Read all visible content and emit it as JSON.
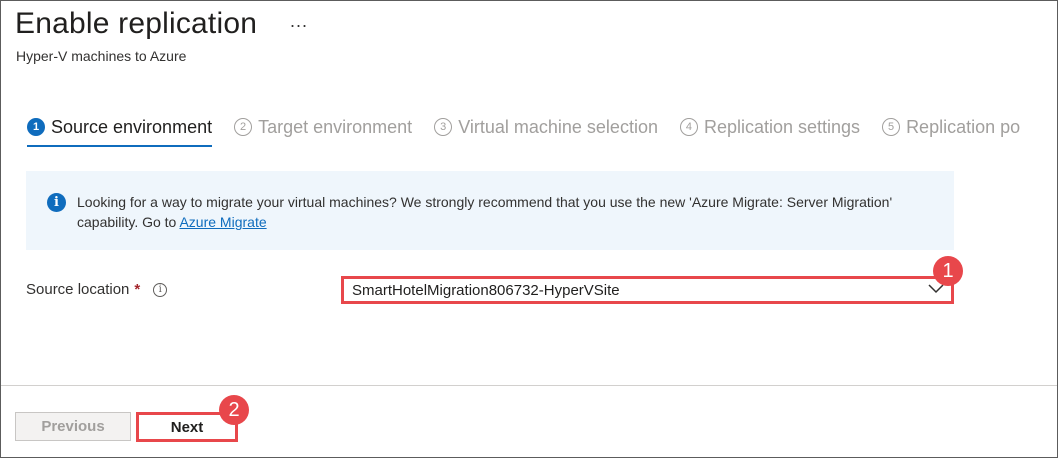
{
  "header": {
    "title": "Enable replication",
    "more_label": "...",
    "subtitle": "Hyper-V machines to Azure"
  },
  "tabs": [
    {
      "num": "1",
      "label": "Source environment",
      "active": true
    },
    {
      "num": "2",
      "label": "Target environment",
      "active": false
    },
    {
      "num": "3",
      "label": "Virtual machine selection",
      "active": false
    },
    {
      "num": "4",
      "label": "Replication settings",
      "active": false
    },
    {
      "num": "5",
      "label": "Replication po",
      "active": false
    }
  ],
  "info": {
    "icon": "info-icon",
    "icon_glyph": "i",
    "text": "Looking for a way to migrate your virtual machines? We strongly recommend that you use the new 'Azure Migrate: Server Migration' capability. Go to ",
    "link": "Azure Migrate"
  },
  "source_location": {
    "label": "Source location",
    "required_mark": "*",
    "info_glyph": "i",
    "value": "SmartHotelMigration806732-HyperVSite"
  },
  "callouts": {
    "one": "1",
    "two": "2"
  },
  "footer": {
    "previous_label": "Previous",
    "next_label": "Next"
  },
  "colors": {
    "accent": "#0f6cbd",
    "highlight": "#e8474b",
    "info_background": "#eff6fc"
  }
}
